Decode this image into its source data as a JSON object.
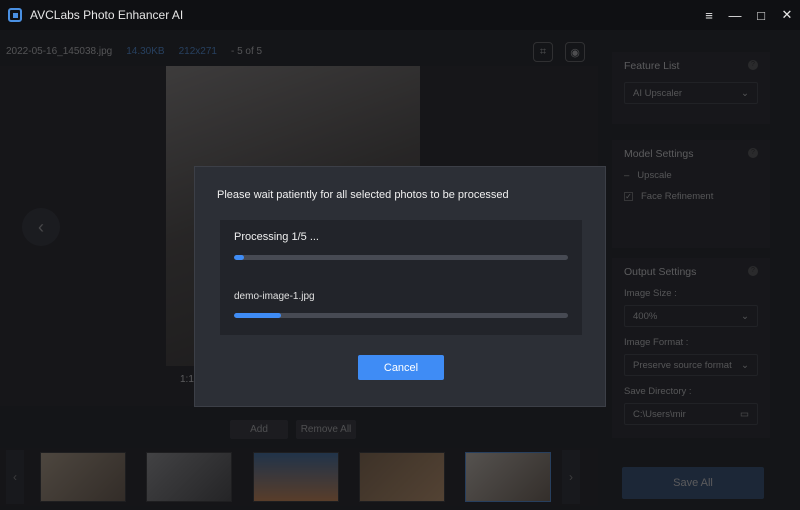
{
  "app": {
    "title": "AVCLabs Photo Enhancer AI"
  },
  "window_controls": [
    "≡",
    "—",
    "□",
    "✕"
  ],
  "info_bar": {
    "filename": "2022-05-16_145038.jpg",
    "size": "14.30KB",
    "dimensions": "212x271",
    "position": "- 5 of 5"
  },
  "preview": {
    "zoom_label": "1:1"
  },
  "actions": {
    "add": "Add",
    "remove_all": "Remove All"
  },
  "side_panel": {
    "feature_list": {
      "title": "Feature List",
      "selected": "AI Upscaler"
    },
    "model_settings": {
      "title": "Model Settings",
      "upscale": "Upscale",
      "face_refinement": "Face Refinement"
    },
    "output_settings": {
      "title": "Output Settings",
      "image_size_label": "Image Size :",
      "image_size": "400%",
      "image_format_label": "Image Format :",
      "image_format": "Preserve source format",
      "save_directory_label": "Save Directory :",
      "save_directory": "C:\\Users\\mir"
    },
    "save_all": "Save All"
  },
  "dialog": {
    "message": "Please wait patiently for all selected photos to be processed",
    "progress_label": "Processing 1/5 ...",
    "overall_progress": 0.03,
    "file_name": "demo-image-1.jpg",
    "file_progress": 0.14,
    "cancel": "Cancel"
  },
  "colors": {
    "accent": "#3f8cf5",
    "dialog_bg": "#2c2f36"
  }
}
